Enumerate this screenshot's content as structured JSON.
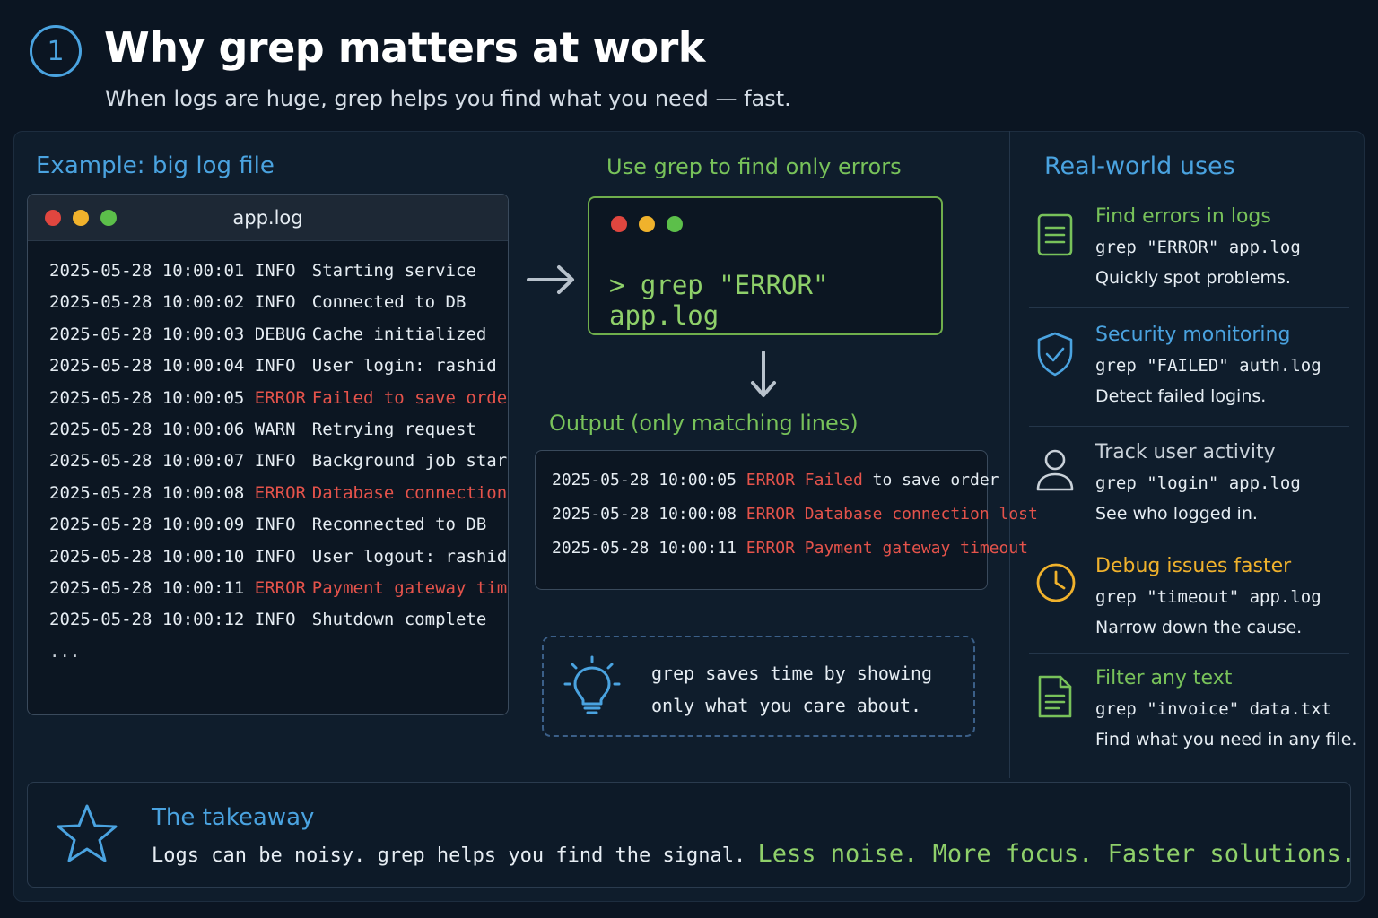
{
  "header": {
    "step_number": "1",
    "title": "Why grep matters at work",
    "subtitle": "When logs are huge, grep helps you find what you need — fast."
  },
  "example": {
    "heading": "Example: big log file",
    "filename": "app.log",
    "lines": [
      {
        "ts": "2025-05-28 10:00:01",
        "level": "INFO",
        "msg": "Starting service",
        "error": false
      },
      {
        "ts": "2025-05-28 10:00:02",
        "level": "INFO",
        "msg": "Connected to DB",
        "error": false
      },
      {
        "ts": "2025-05-28 10:00:03",
        "level": "DEBUG",
        "msg": "Cache initialized",
        "error": false
      },
      {
        "ts": "2025-05-28 10:00:04",
        "level": "INFO",
        "msg": "User login: rashid",
        "error": false
      },
      {
        "ts": "2025-05-28 10:00:05",
        "level": "ERROR",
        "msg": "Failed to save order",
        "error": true
      },
      {
        "ts": "2025-05-28 10:00:06",
        "level": "WARN",
        "msg": "Retrying request",
        "error": false
      },
      {
        "ts": "2025-05-28 10:00:07",
        "level": "INFO",
        "msg": "Background job started",
        "error": false
      },
      {
        "ts": "2025-05-28 10:00:08",
        "level": "ERROR",
        "msg": "Database connection lost",
        "error": true
      },
      {
        "ts": "2025-05-28 10:00:09",
        "level": "INFO",
        "msg": "Reconnected to DB",
        "error": false
      },
      {
        "ts": "2025-05-28 10:00:10",
        "level": "INFO",
        "msg": "User logout: rashid",
        "error": false
      },
      {
        "ts": "2025-05-28 10:00:11",
        "level": "ERROR",
        "msg": "Payment gateway timeout",
        "error": true
      },
      {
        "ts": "2025-05-28 10:00:12",
        "level": "INFO",
        "msg": "Shutdown complete",
        "error": false
      }
    ],
    "ellipsis": "..."
  },
  "command": {
    "heading": "Use grep to find only errors",
    "text": "> grep \"ERROR\" app.log"
  },
  "output": {
    "heading": "Output (only matching lines)",
    "lines": [
      {
        "ts": "2025-05-28 10:00:05",
        "red": "ERROR Failed",
        "rest": " to save order"
      },
      {
        "ts": "2025-05-28 10:00:08",
        "red": "ERROR Database connection lost",
        "rest": ""
      },
      {
        "ts": "2025-05-28 10:00:11",
        "red": "ERROR Payment gateway timeout",
        "rest": ""
      }
    ]
  },
  "tip": {
    "line1": "grep saves time by showing",
    "line2": "only what you care about.",
    "icon": "lightbulb-icon"
  },
  "uses": {
    "heading": "Real-world uses",
    "items": [
      {
        "title": "Find errors in logs",
        "cmd": "grep \"ERROR\" app.log",
        "desc": "Quickly spot problems.",
        "color": "#78c25a",
        "icon": "document-icon"
      },
      {
        "title": "Security monitoring",
        "cmd": "grep \"FAILED\" auth.log",
        "desc": "Detect failed logins.",
        "color": "#4aa3e0",
        "icon": "shield-check-icon"
      },
      {
        "title": "Track user activity",
        "cmd": "grep \"login\" app.log",
        "desc": "See who logged in.",
        "color": "#c9d1d9",
        "icon": "user-icon"
      },
      {
        "title": "Debug issues faster",
        "cmd": "grep \"timeout\" app.log",
        "desc": "Narrow down the cause.",
        "color": "#f0b22c",
        "icon": "clock-icon"
      },
      {
        "title": "Filter any text",
        "cmd": "grep \"invoice\" data.txt",
        "desc": "Find what you need in any file.",
        "color": "#78c25a",
        "icon": "file-text-icon"
      }
    ]
  },
  "takeaway": {
    "title": "The takeaway",
    "text": "Logs can be noisy. grep helps you find the signal. ",
    "highlight": "Less noise. More focus. Faster solutions.",
    "icon": "star-icon"
  },
  "colors": {
    "background": "#0b1522",
    "accent_blue": "#4aa3e0",
    "accent_green": "#78c25a",
    "error_red": "#e5534b",
    "warning_amber": "#f0b22c"
  }
}
